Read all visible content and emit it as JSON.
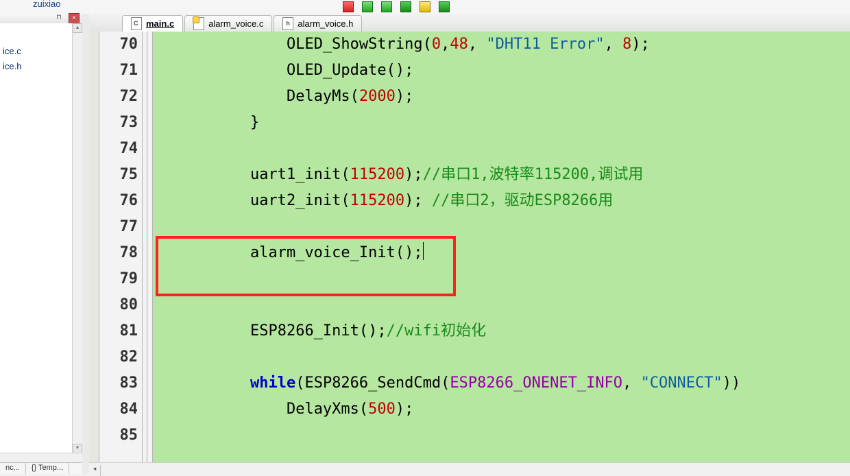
{
  "toolbar": {
    "item_text": "zuixiao"
  },
  "left_pane": {
    "pin_glyph": "⊓",
    "close_glyph": "×",
    "files": [
      "ice.c",
      "ice.h"
    ],
    "up_glyph": "▴",
    "down_glyph": "▾",
    "bottom_tabs": [
      "nc...",
      "{} Temp..."
    ]
  },
  "tabs": [
    {
      "label": "main.c",
      "icon": "c",
      "active": true
    },
    {
      "label": "alarm_voice.c",
      "icon": "c-mod",
      "active": false
    },
    {
      "label": "alarm_voice.h",
      "icon": "h",
      "active": false
    }
  ],
  "code": {
    "first_line_no": 70,
    "lines": [
      {
        "no": 70,
        "segs": [
          [
            "indent",
            "            "
          ],
          [
            "fn",
            "OLED_ShowString"
          ],
          [
            "p",
            "("
          ],
          [
            "num",
            "0"
          ],
          [
            "p",
            ","
          ],
          [
            "num",
            "48"
          ],
          [
            "p",
            ", "
          ],
          [
            "str",
            "\"DHT11 Error\""
          ],
          [
            "p",
            ", "
          ],
          [
            "num",
            "8"
          ],
          [
            "p",
            ");"
          ]
        ]
      },
      {
        "no": 71,
        "segs": [
          [
            "indent",
            "            "
          ],
          [
            "fn",
            "OLED_Update"
          ],
          [
            "p",
            "();"
          ]
        ]
      },
      {
        "no": 72,
        "segs": [
          [
            "indent",
            "            "
          ],
          [
            "fn",
            "DelayMs"
          ],
          [
            "p",
            "("
          ],
          [
            "num",
            "2000"
          ],
          [
            "p",
            ");"
          ]
        ]
      },
      {
        "no": 73,
        "segs": [
          [
            "indent",
            "        "
          ],
          [
            "p",
            "}"
          ]
        ]
      },
      {
        "no": 74,
        "segs": []
      },
      {
        "no": 75,
        "segs": [
          [
            "indent",
            "        "
          ],
          [
            "fn",
            "uart1_init"
          ],
          [
            "p",
            "("
          ],
          [
            "num",
            "115200"
          ],
          [
            "p",
            ");"
          ],
          [
            "cm",
            "//串口1,波特率115200,调试用"
          ]
        ]
      },
      {
        "no": 76,
        "segs": [
          [
            "indent",
            "        "
          ],
          [
            "fn",
            "uart2_init"
          ],
          [
            "p",
            "("
          ],
          [
            "num",
            "115200"
          ],
          [
            "p",
            "); "
          ],
          [
            "cm",
            "//串口2，驱动ESP8266用"
          ]
        ]
      },
      {
        "no": 77,
        "segs": []
      },
      {
        "no": 78,
        "segs": [
          [
            "indent",
            "        "
          ],
          [
            "fn",
            "alarm_voice_Init"
          ],
          [
            "p",
            "();"
          ],
          [
            "caret",
            ""
          ]
        ]
      },
      {
        "no": 79,
        "segs": []
      },
      {
        "no": 80,
        "segs": []
      },
      {
        "no": 81,
        "segs": [
          [
            "indent",
            "        "
          ],
          [
            "fn",
            "ESP8266_Init"
          ],
          [
            "p",
            "();"
          ],
          [
            "cm",
            "//wifi初始化"
          ]
        ]
      },
      {
        "no": 82,
        "segs": []
      },
      {
        "no": 83,
        "segs": [
          [
            "indent",
            "        "
          ],
          [
            "kw",
            "while"
          ],
          [
            "p",
            "("
          ],
          [
            "fn",
            "ESP8266_SendCmd"
          ],
          [
            "p",
            "("
          ],
          [
            "id",
            "ESP8266_ONENET_INFO"
          ],
          [
            "p",
            ", "
          ],
          [
            "str",
            "\"CONNECT\""
          ],
          [
            "p",
            "))"
          ]
        ]
      },
      {
        "no": 84,
        "segs": [
          [
            "indent",
            "            "
          ],
          [
            "fn",
            "DelayXms"
          ],
          [
            "p",
            "("
          ],
          [
            "num",
            "500"
          ],
          [
            "p",
            ");"
          ]
        ]
      },
      {
        "no": 85,
        "segs": []
      }
    ]
  },
  "highlight": {
    "from_line": 78,
    "to_line": 79
  },
  "hscroll": {
    "left_glyph": "◂"
  }
}
